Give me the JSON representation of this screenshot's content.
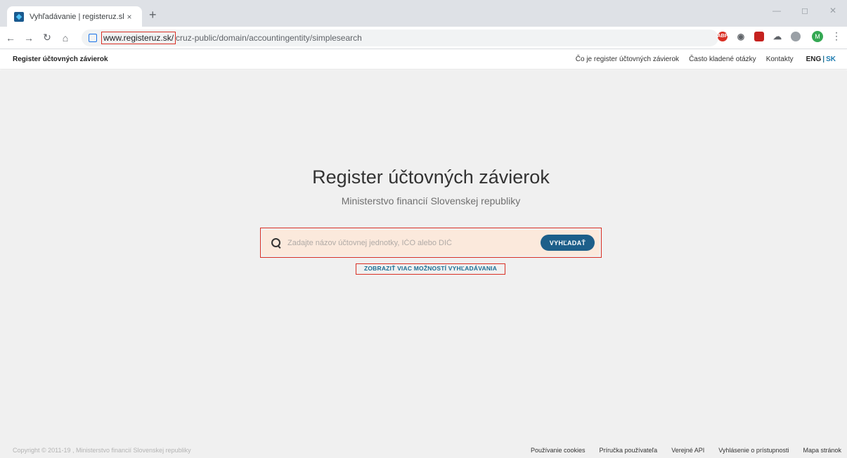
{
  "browser": {
    "tab_title": "Vyhľadávanie | registeruz.sk",
    "tab_close": "×",
    "new_tab": "+",
    "url_host": "www.registeruz.sk/",
    "url_path": "cruz-public/domain/accountingentity/simplesearch",
    "profile_initial": "M",
    "ext_abp_label": "ABP"
  },
  "header": {
    "brand": "Register účtovných závierok",
    "nav": [
      "Čo je register účtovných závierok",
      "Často kladené otázky",
      "Kontakty"
    ],
    "lang_eng": "ENG",
    "lang_sep": "|",
    "lang_sk": "SK"
  },
  "main": {
    "title": "Register účtovných závierok",
    "subtitle": "Ministerstvo financií Slovenskej republiky",
    "search_placeholder": "Zadajte názov účtovnej jednotky, IČO alebo DIČ",
    "search_button": "VYHĽADAŤ",
    "more_options": "ZOBRAZIŤ VIAC MOŽNOSTÍ VYHĽADÁVANIA"
  },
  "footer": {
    "copyright": "Copyright © 2011-19 , Ministerstvo financií Slovenskej republiky",
    "links": [
      "Používanie cookies",
      "Príručka používateľa",
      "Verejné API",
      "Vyhlásenie o prístupnosti",
      "Mapa stránok"
    ]
  }
}
